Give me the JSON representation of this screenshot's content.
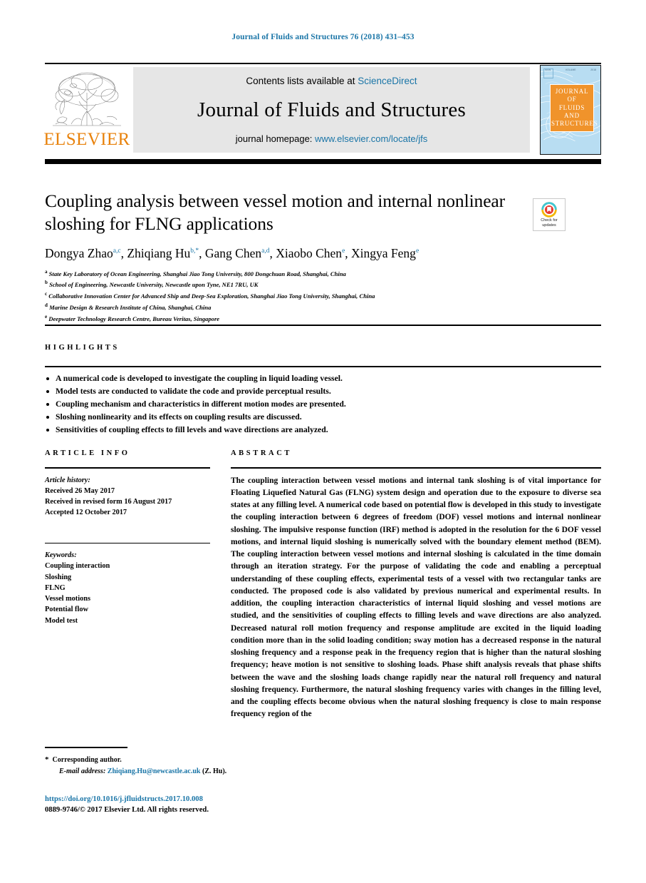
{
  "running_head": "Journal of Fluids and Structures 76 (2018) 431–453",
  "masthead": {
    "contents_prefix": "Contents lists available at",
    "contents_link": "ScienceDirect",
    "journal_name": "Journal of Fluids and Structures",
    "homepage_prefix": "journal homepage:",
    "homepage_url": "www.elsevier.com/locate/jfs",
    "publisher": "ELSEVIER",
    "cover_title_lines": [
      "JOURNAL OF",
      "FLUIDS AND",
      "STRUCTURES"
    ]
  },
  "crossmark": {
    "line1": "Check for",
    "line2": "updates"
  },
  "article": {
    "title": "Coupling analysis between vessel motion and internal nonlinear sloshing for FLNG applications",
    "authors": [
      {
        "name": "Dongya Zhao",
        "sup": "a,c",
        "star": false
      },
      {
        "name": "Zhiqiang Hu",
        "sup": "b,",
        "star": true
      },
      {
        "name": "Gang Chen",
        "sup": "a,d",
        "star": false
      },
      {
        "name": "Xiaobo Chen",
        "sup": "e",
        "star": false
      },
      {
        "name": "Xingya Feng",
        "sup": "e",
        "star": false
      }
    ],
    "affiliations": [
      {
        "mark": "a",
        "text": "State Key Laboratory of Ocean Engineering, Shanghai Jiao Tong University, 800 Dongchuan Road, Shanghai, China"
      },
      {
        "mark": "b",
        "text": "School of Engineering, Newcastle University, Newcastle upon Tyne, NE1 7RU, UK"
      },
      {
        "mark": "c",
        "text": "Collaborative Innovation Center for Advanced Ship and Deep-Sea Exploration, Shanghai Jiao Tong University, Shanghai, China"
      },
      {
        "mark": "d",
        "text": "Marine Design & Research Institute of China, Shanghai, China"
      },
      {
        "mark": "e",
        "text": "Deepwater Technology Research Centre, Bureau Veritas, Singapore"
      }
    ]
  },
  "highlights": {
    "label": "HIGHLIGHTS",
    "items": [
      "A numerical code is developed to investigate the coupling in liquid loading vessel.",
      "Model tests are conducted to validate the code and provide perceptual results.",
      "Coupling mechanism and characteristics in different motion modes are presented.",
      "Sloshing nonlinearity and its effects on coupling results are discussed.",
      "Sensitivities of coupling effects to fill levels and wave directions are analyzed."
    ]
  },
  "article_info": {
    "label": "ARTICLE INFO",
    "history_label": "Article history:",
    "history": [
      "Received 26 May 2017",
      "Received in revised form 16 August 2017",
      "Accepted 12 October 2017"
    ],
    "keywords_label": "Keywords:",
    "keywords": [
      "Coupling interaction",
      "Sloshing",
      "FLNG",
      "Vessel motions",
      "Potential flow",
      "Model test"
    ]
  },
  "abstract": {
    "label": "ABSTRACT",
    "text": "The coupling interaction between vessel motions and internal tank sloshing is of vital importance for Floating Liquefied Natural Gas (FLNG) system design and operation due to the exposure to diverse sea states at any filling level. A numerical code based on potential flow is developed in this study to investigate the coupling interaction between 6 degrees of freedom (DOF) vessel motions and internal nonlinear sloshing. The impulsive response function (IRF) method is adopted in the resolution for the 6 DOF vessel motions, and internal liquid sloshing is numerically solved with the boundary element method (BEM). The coupling interaction between vessel motions and internal sloshing is calculated in the time domain through an iteration strategy. For the purpose of validating the code and enabling a perceptual understanding of these coupling effects, experimental tests of a vessel with two rectangular tanks are conducted. The proposed code is also validated by previous numerical and experimental results. In addition, the coupling interaction characteristics of internal liquid sloshing and vessel motions are studied, and the sensitivities of coupling effects to filling levels and wave directions are also analyzed. Decreased natural roll motion frequency and response amplitude are excited in the liquid loading condition more than in the solid loading condition; sway motion has a decreased response in the natural sloshing frequency and a response peak in the frequency region that is higher than the natural sloshing frequency; heave motion is not sensitive to sloshing loads. Phase shift analysis reveals that phase shifts between the wave and the sloshing loads change rapidly near the natural roll frequency and natural sloshing frequency. Furthermore, the natural sloshing frequency varies with changes in the filling level, and the coupling effects become obvious when the natural sloshing frequency is close to main response frequency region of the"
  },
  "footnote": {
    "star": "*",
    "corresponding": "Corresponding author.",
    "email_label": "E-mail address:",
    "email": "Zhiqiang.Hu@newcastle.ac.uk",
    "email_suffix": "(Z. Hu)."
  },
  "footer": {
    "doi": "https://doi.org/10.1016/j.jfluidstructs.2017.10.008",
    "copyright": "0889-9746/© 2017 Elsevier Ltd. All rights reserved."
  },
  "colors": {
    "link_blue": "#1a75a7",
    "elsevier_orange": "#e8820c",
    "cover_blue": "#b8ddf2",
    "cover_title_orange": "#f0932b"
  }
}
